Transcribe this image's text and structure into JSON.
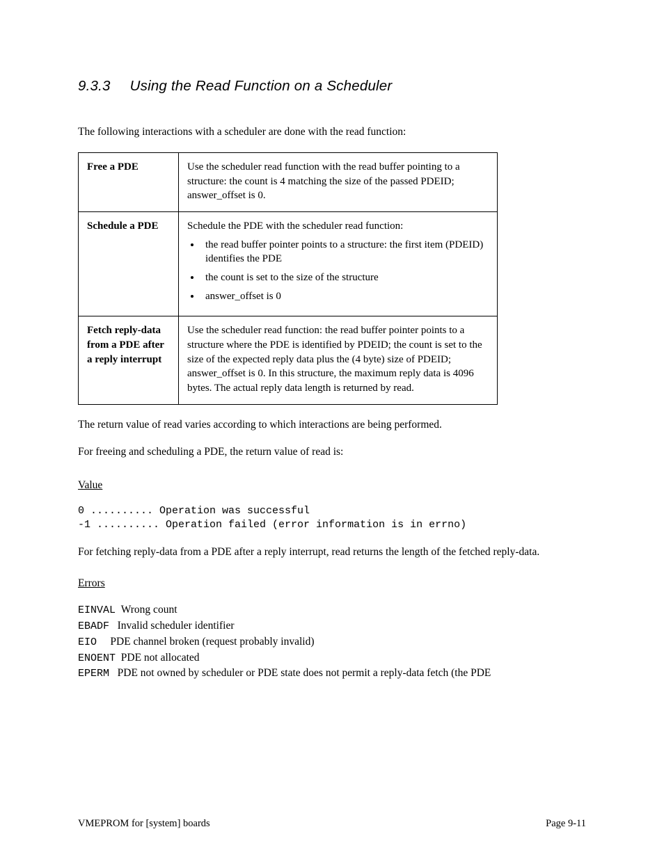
{
  "heading": {
    "number": "9.3.3",
    "title": "Using the Read Function on a Scheduler"
  },
  "intro": "The following interactions with a scheduler are done with the read function:",
  "table": {
    "rows": [
      {
        "label": "Free a PDE",
        "desc": "Use the scheduler read function with the read buffer pointing to a structure: the count is 4 matching the size of the passed PDEID; answer_offset is 0."
      },
      {
        "label": "Schedule a PDE",
        "lead": "Schedule the PDE with the scheduler read function:",
        "bullets": [
          "the read buffer pointer points to a structure: the first item (PDEID) identifies the PDE",
          "the count is set to the size of the structure",
          "answer_offset is 0"
        ]
      },
      {
        "label": "Fetch reply-data from a PDE after a reply interrupt",
        "desc": "Use the scheduler read function: the read buffer pointer points to a structure where the PDE is identified by PDEID; the count is set to the size of the expected reply data plus the (4 byte) size of PDEID; answer_offset is 0. In this structure, the maximum reply data is 4096 bytes. The actual reply data length is returned by read."
      }
    ]
  },
  "paragraphs": [
    "The return value of read varies according to which interactions are being performed.",
    "For freeing and scheduling a PDE, the return value of read is:"
  ],
  "values_block_1": {
    "label": "Value",
    "lines": [
      "0 .......... Operation was successful",
      "-1 .......... Operation failed (error information is in errno)"
    ]
  },
  "paragraph_3": "For fetching reply-data from a PDE after a reply interrupt, read returns the length of the fetched reply-data.",
  "errors_block": {
    "label": "Errors",
    "lines": [
      {
        "code": "EINVAL",
        "text": "Wrong count"
      },
      {
        "code": "EBADF",
        "text": "Invalid scheduler identifier"
      },
      {
        "code": "EIO",
        "text": "PDE channel broken (request probably invalid)"
      },
      {
        "code": "ENOENT",
        "text": "PDE not allocated"
      },
      {
        "code": "EPERM",
        "text": "PDE not owned by scheduler or PDE state does not permit a reply-data fetch (the PDE"
      }
    ]
  },
  "footer": {
    "left": "VMEPROM for [system] boards",
    "right": "Page 9-11"
  }
}
